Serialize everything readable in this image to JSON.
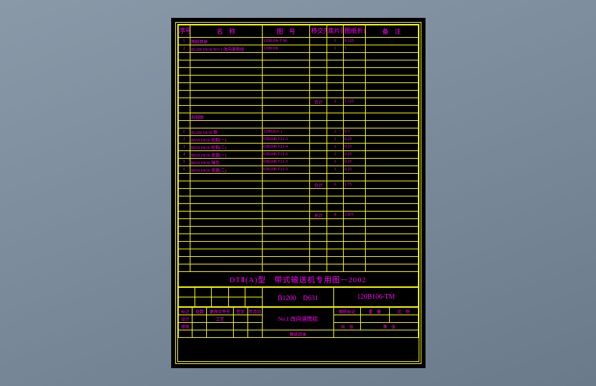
{
  "header": {
    "c1": "序号",
    "c2": "名　称",
    "c3": "图　号",
    "c4": "移交序号",
    "c5": "底片张数",
    "c6": "图纸折合A1",
    "c7": "备　注"
  },
  "rows1": [
    {
      "n": "1",
      "name": "图纸目录",
      "code": "120B10b-T M",
      "a": "",
      "b": "1",
      "c": "0.125",
      "d": ""
    },
    {
      "n": "2",
      "name": "B1200 D630 NO.1 改向滚筒组",
      "code": "120B10b",
      "a": "",
      "b": "1",
      "c": "1",
      "d": ""
    }
  ],
  "sum1": {
    "label": "合计",
    "b": "2",
    "c": "1.125"
  },
  "diagram_label": "剖视图",
  "rows2": [
    {
      "n": "1",
      "name": "B1200 D630 筒",
      "code": "120B20A-1",
      "a": "",
      "b": "1",
      "c": "0.5",
      "d": ""
    },
    {
      "n": "2",
      "name": "B650 D630 轮毂(一)",
      "code": "65B20B T21-3",
      "a": "",
      "b": "1",
      "c": "0.25",
      "d": ""
    },
    {
      "n": "3",
      "name": "B650 D630 轮毂(二)",
      "code": "65B20B T21-4",
      "a": "",
      "b": "1",
      "c": "0.25",
      "d": ""
    },
    {
      "n": "4",
      "name": "B650 D630 底盘(一)",
      "code": "65B20B T21-5",
      "a": "",
      "b": "1",
      "c": "0.25",
      "d": ""
    },
    {
      "n": "5",
      "name": "B650 D630 轴瓦",
      "code": "65B20B T21-5",
      "a": "",
      "b": "1",
      "c": "0.25",
      "d": ""
    },
    {
      "n": "6",
      "name": "B650 D630 底盘(二)",
      "code": "65B20B T21-5",
      "a": "",
      "b": "1",
      "c": "0.25",
      "d": ""
    }
  ],
  "sum2": {
    "label": "合计",
    "b": "6",
    "c": "1.75"
  },
  "sum3": {
    "label": "总计",
    "b": "8",
    "c": "2.875"
  },
  "title": "DTⅡ(A)型　带式输送机专用图－2002",
  "block": {
    "code1": "B1200　D631",
    "code2": "120B106-TM",
    "sub": "No.1 改向滚筒组",
    "footer": "图纸目录",
    "l1": "标记",
    "l2": "处数",
    "l3": "更改文件号",
    "l4": "签字",
    "l5": "年月日",
    "l6": "设计",
    "l7": "工艺",
    "l8": "审核",
    "r1": "图样标记",
    "r2": "重　量",
    "r3": "比　例",
    "r4": "共　张",
    "r5": "第　张"
  }
}
